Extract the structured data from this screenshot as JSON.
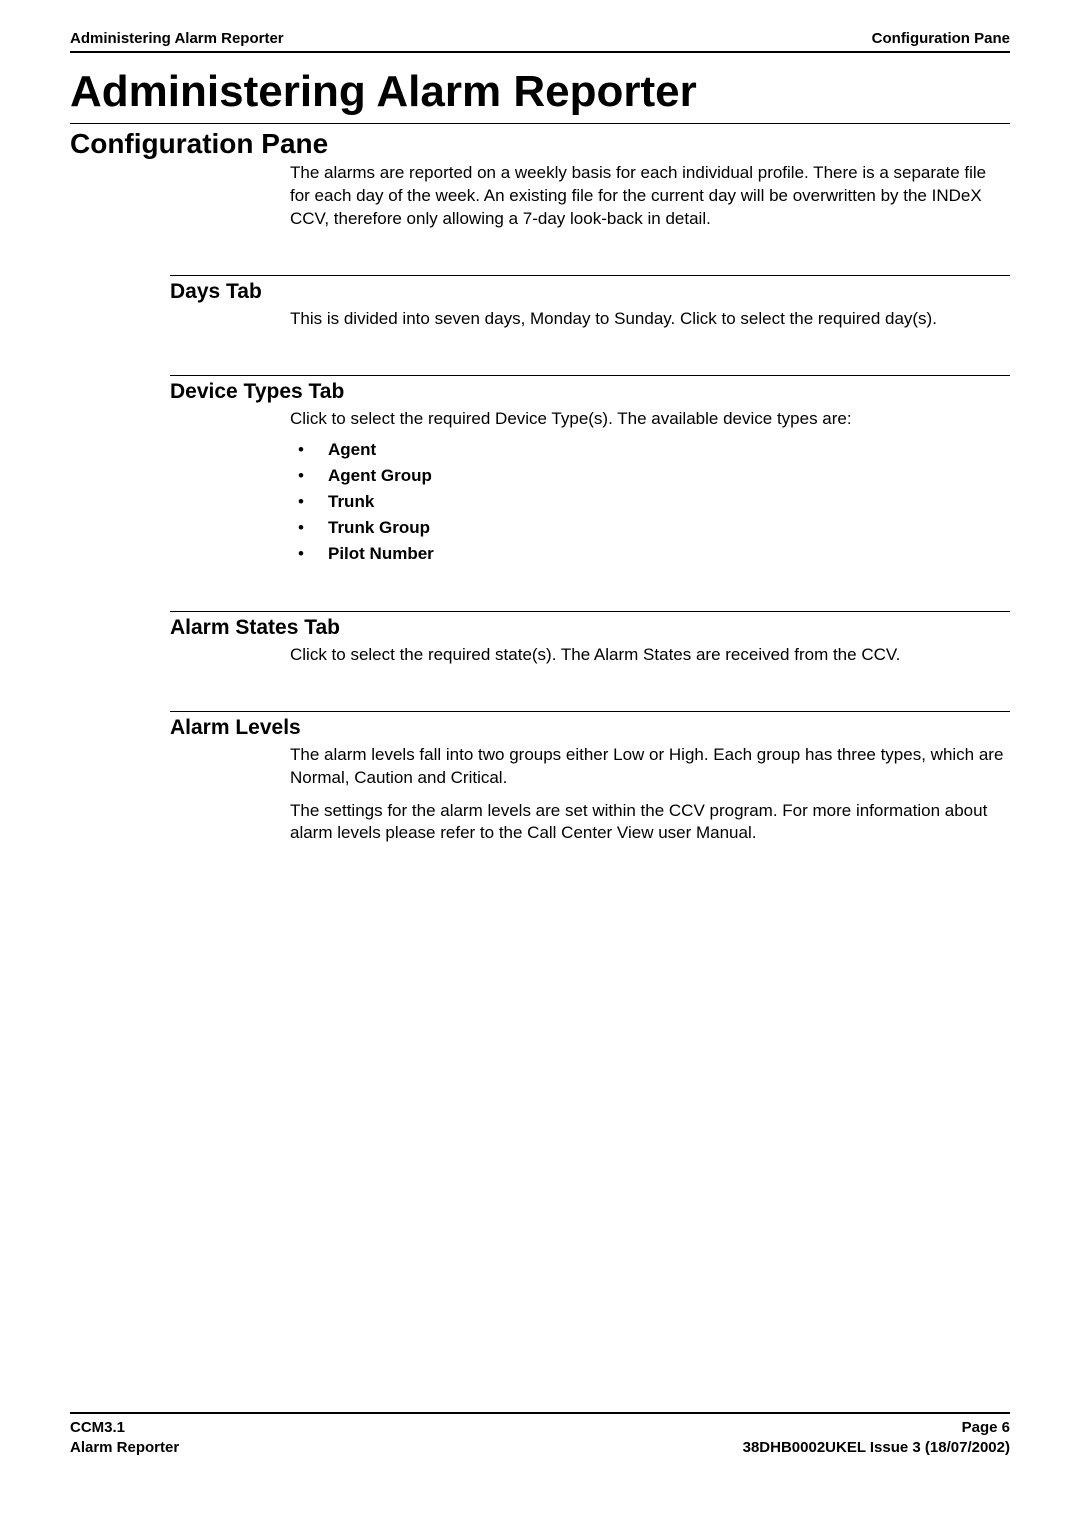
{
  "header": {
    "left": "Administering Alarm Reporter",
    "right": "Configuration Pane"
  },
  "mainTitle": "Administering Alarm Reporter",
  "h1": "Configuration Pane",
  "intro": "The alarms are reported on a weekly basis for each individual profile. There is a separate file for each day of the week.  An existing file for the current day will be overwritten by the INDeX CCV, therefore only allowing a 7-day look-back in detail.",
  "sections": {
    "days": {
      "title": "Days Tab",
      "text": "This is divided into seven days, Monday to Sunday.  Click to select the required day(s)."
    },
    "deviceTypes": {
      "title": "Device Types Tab",
      "text": "Click to select the required Device Type(s).  The available device types are:",
      "items": [
        "Agent",
        "Agent Group",
        "Trunk",
        "Trunk Group",
        "Pilot Number"
      ]
    },
    "alarmStates": {
      "title": "Alarm States Tab",
      "text": "Click to select the required state(s).  The Alarm States are received from the CCV."
    },
    "alarmLevels": {
      "title": "Alarm Levels",
      "para1": "The alarm levels fall into two groups either Low or High.  Each group has three types, which are Normal, Caution and Critical.",
      "para2": "The settings for the alarm levels are set within the CCV program.  For more information about alarm levels please refer to the Call Center View user Manual."
    }
  },
  "footer": {
    "leftLine1": "CCM3.1",
    "leftLine2": "Alarm Reporter",
    "rightLine1": "Page 6",
    "rightLine2": "38DHB0002UKEL Issue 3 (18/07/2002)"
  }
}
